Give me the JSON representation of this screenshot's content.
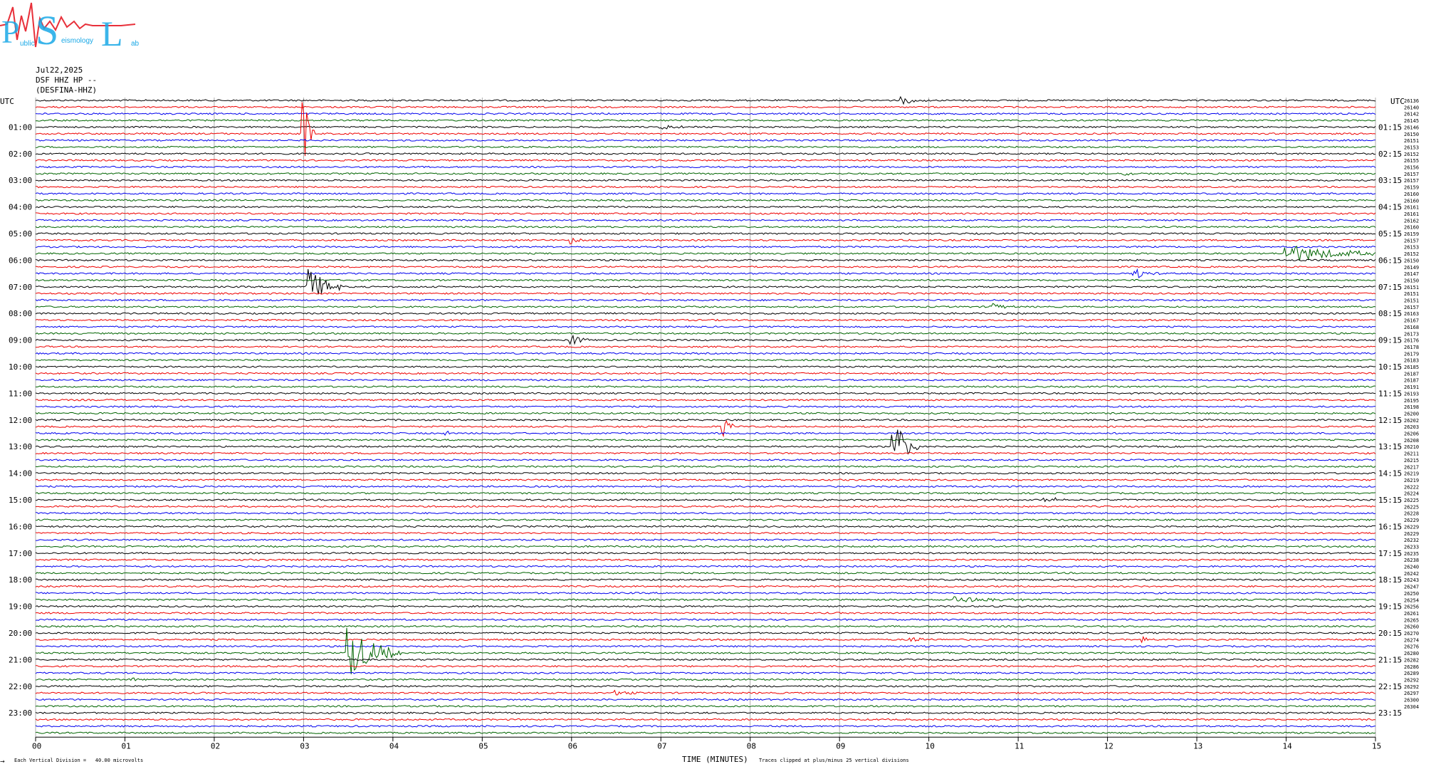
{
  "logo": {
    "letters": [
      "P",
      "S",
      "L"
    ],
    "small_text": [
      "ublic",
      "eismology",
      "ab"
    ]
  },
  "header": {
    "date": "Jul22,2025",
    "station": "DSF HHZ HP --",
    "station_name": "(DESFINA-HHZ)"
  },
  "colors": {
    "black": "#000000",
    "red": "#ee0000",
    "blue": "#0000ee",
    "green": "#006400",
    "grid": "#999999",
    "logo_cyan": "#19a8e6",
    "logo_red": "#e8303a"
  },
  "footer": {
    "left_note": "Each Vertical Division =   40.00 microvolts",
    "corner": "→",
    "xlabel": "TIME (MINUTES)",
    "clip_note": "Traces clipped at plus/minus 25 vertical divisions"
  },
  "chart_data": {
    "type": "line",
    "title": "",
    "xlabel": "TIME (MINUTES)",
    "ylabel": "",
    "xlim": [
      0,
      15
    ],
    "x_ticks": [
      "00",
      "01",
      "02",
      "03",
      "04",
      "05",
      "06",
      "07",
      "08",
      "09",
      "10",
      "11",
      "12",
      "13",
      "14",
      "15"
    ],
    "left_axis_label": "UTC",
    "right_axis_label": "UTC",
    "left_hour_labels": [
      "01:00",
      "02:00",
      "03:00",
      "04:00",
      "05:00",
      "06:00",
      "07:00",
      "08:00",
      "09:00",
      "10:00",
      "11:00",
      "12:00",
      "13:00",
      "14:00",
      "15:00",
      "16:00",
      "17:00",
      "18:00",
      "19:00",
      "20:00",
      "21:00",
      "22:00",
      "23:00"
    ],
    "right_hour_labels": [
      "01:15",
      "02:15",
      "03:15",
      "04:15",
      "05:15",
      "06:15",
      "07:15",
      "08:15",
      "09:15",
      "10:15",
      "11:15",
      "12:15",
      "13:15",
      "14:15",
      "15:15",
      "16:15",
      "17:15",
      "18:15",
      "19:15",
      "20:15",
      "21:15",
      "22:15",
      "23:15"
    ],
    "trace_minutes": 15,
    "trace_count": 96,
    "trace_color_cycle": [
      "black",
      "red",
      "blue",
      "green"
    ],
    "trace_offsets": [
      "26136",
      "26140",
      "26142",
      "26145",
      "26146",
      "26150",
      "26151",
      "26153",
      "26152",
      "26155",
      "26156",
      "26157",
      "26157",
      "26159",
      "26160",
      "26160",
      "26161",
      "26161",
      "26162",
      "26160",
      "26159",
      "26157",
      "26153",
      "26152",
      "26150",
      "26149",
      "26147",
      "26150",
      "26151",
      "26151",
      "26151",
      "26157",
      "26163",
      "26167",
      "26168",
      "26173",
      "26176",
      "26178",
      "26179",
      "26183",
      "26185",
      "26187",
      "26187",
      "26191",
      "26193",
      "26195",
      "26198",
      "26200",
      "26202",
      "26203",
      "26206",
      "26208",
      "26210",
      "26211",
      "26215",
      "26217",
      "26219",
      "26219",
      "26222",
      "26224",
      "26225",
      "26225",
      "26228",
      "26229",
      "26229",
      "26229",
      "26232",
      "26233",
      "26235",
      "26238",
      "26240",
      "26242",
      "26243",
      "26247",
      "26250",
      "26254",
      "26256",
      "26261",
      "26265",
      "26260",
      "26270",
      "26274",
      "26276",
      "26280",
      "26282",
      "26286",
      "26289",
      "26292",
      "26292",
      "26297",
      "26300",
      "26304"
    ],
    "events": [
      {
        "trace": 5,
        "minute": 3.0,
        "duration": 0.12,
        "amp": 6,
        "clipped": true
      },
      {
        "trace": 28,
        "minute": 3.05,
        "duration": 0.4,
        "amp": 3
      },
      {
        "trace": 0,
        "minute": 9.7,
        "duration": 0.3,
        "amp": 0.6
      },
      {
        "trace": 23,
        "minute": 14.0,
        "duration": 1.2,
        "amp": 1.4
      },
      {
        "trace": 21,
        "minute": 6.0,
        "duration": 0.2,
        "amp": 0.5
      },
      {
        "trace": 26,
        "minute": 12.3,
        "duration": 0.3,
        "amp": 0.8
      },
      {
        "trace": 31,
        "minute": 10.7,
        "duration": 0.3,
        "amp": 0.6
      },
      {
        "trace": 36,
        "minute": 6.0,
        "duration": 0.2,
        "amp": 0.9
      },
      {
        "trace": 50,
        "minute": 4.6,
        "duration": 0.2,
        "amp": 0.7
      },
      {
        "trace": 49,
        "minute": 7.7,
        "duration": 0.2,
        "amp": 1.4
      },
      {
        "trace": 52,
        "minute": 9.6,
        "duration": 0.3,
        "amp": 4
      },
      {
        "trace": 83,
        "minute": 3.5,
        "duration": 0.6,
        "amp": 4
      },
      {
        "trace": 89,
        "minute": 6.5,
        "duration": 0.3,
        "amp": 0.4
      },
      {
        "trace": 87,
        "minute": 1.05,
        "duration": 0.1,
        "amp": 0.6
      },
      {
        "trace": 81,
        "minute": 9.8,
        "duration": 0.3,
        "amp": 0.6
      },
      {
        "trace": 81,
        "minute": 12.4,
        "duration": 0.2,
        "amp": 0.4
      },
      {
        "trace": 75,
        "minute": 10.3,
        "duration": 0.8,
        "amp": 0.6
      },
      {
        "trace": 4,
        "minute": 7.0,
        "duration": 0.5,
        "amp": 0.3
      },
      {
        "trace": 11,
        "minute": 12.2,
        "duration": 0.2,
        "amp": 0.3
      },
      {
        "trace": 60,
        "minute": 11.3,
        "duration": 0.8,
        "amp": 0.3
      }
    ]
  }
}
